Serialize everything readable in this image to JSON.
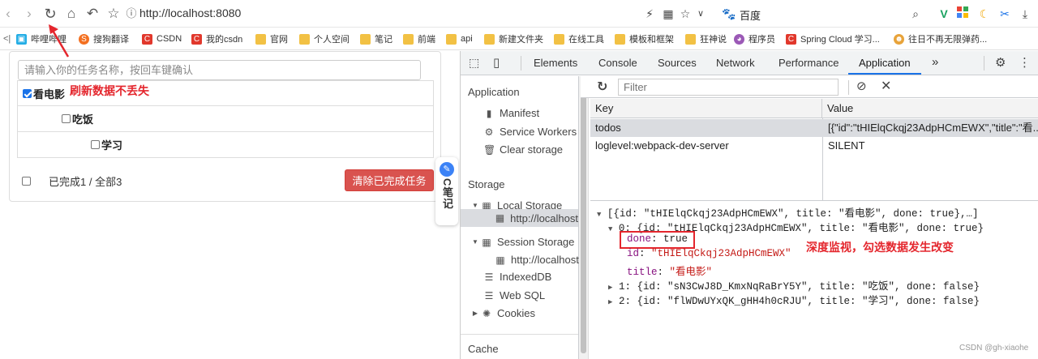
{
  "browser": {
    "url": "http://localhost:8080",
    "search_engine": "百度",
    "bookmarks": [
      "哔哩哔哩",
      "搜狗翻译",
      "CSDN",
      "我的csdn",
      "官网",
      "个人空间",
      "笔记",
      "前端",
      "api",
      "新建文件夹",
      "在线工具",
      "模板和框架",
      "狂神说",
      "程序员",
      "Spring Cloud 学习...",
      "往日不再无限弹药..."
    ]
  },
  "app": {
    "placeholder": "请输入你的任务名称，按回车键确认",
    "todos": [
      {
        "title": "看电影",
        "done": true
      },
      {
        "title": "吃饭",
        "done": false
      },
      {
        "title": "学习",
        "done": false
      }
    ],
    "footer_text": "已完成1 / 全部3",
    "clear_button": "清除已完成任务",
    "note": "刷新数据不丢失"
  },
  "side_widget": {
    "label": "C笔记"
  },
  "devtools": {
    "tabs": [
      "Elements",
      "Console",
      "Sources",
      "Network",
      "Performance",
      "Application"
    ],
    "more_tabs": "»",
    "active_tab": "Application",
    "filter_placeholder": "Filter",
    "sidebar": {
      "app_section": "Application",
      "app_items": [
        "Manifest",
        "Service Workers",
        "Clear storage"
      ],
      "storage_section": "Storage",
      "local_storage": "Local Storage",
      "local_storage_origin": "http://localhost",
      "session_storage": "Session Storage",
      "session_storage_origin": "http://localhost",
      "indexeddb": "IndexedDB",
      "websql": "Web SQL",
      "cookies": "Cookies",
      "cache_section": "Cache"
    },
    "grid": {
      "headers": [
        "Key",
        "Value"
      ],
      "rows": [
        {
          "key": "todos",
          "value": "[{\"id\":\"tHIElqCkqj23AdpHCmEWX\",\"title\":\"看..."
        },
        {
          "key": "loglevel:webpack-dev-server",
          "value": "SILENT"
        }
      ]
    },
    "preview": {
      "line0": "[{id: \"tHIElqCkqj23AdpHCmEWX\", title: \"看电影\", done: true},…]",
      "line1": "0: {id: \"tHIElqCkqj23AdpHCmEWX\", title: \"看电影\", done: true}",
      "done_key": "done",
      "done_val": "true",
      "id_key": "id",
      "id_val": "\"tHIElqCkqj23AdpHCmEWX\"",
      "title_key": "title",
      "title_val": "\"看电影\"",
      "line2": "1: {id: \"sN3CwJ8D_KmxNqRaBrY5Y\", title: \"吃饭\", done: false}",
      "line3": "2: {id: \"flWDwUYxQK_gHH4h0cRJU\", title: \"学习\", done: false}"
    },
    "note": "深度监视，勾选数据发生改变"
  },
  "watermark": "CSDN @gh-xiaohe",
  "colors": {
    "accent": "#1a73e8",
    "annotation": "#e4262d",
    "clear_button": "#d9534f"
  }
}
